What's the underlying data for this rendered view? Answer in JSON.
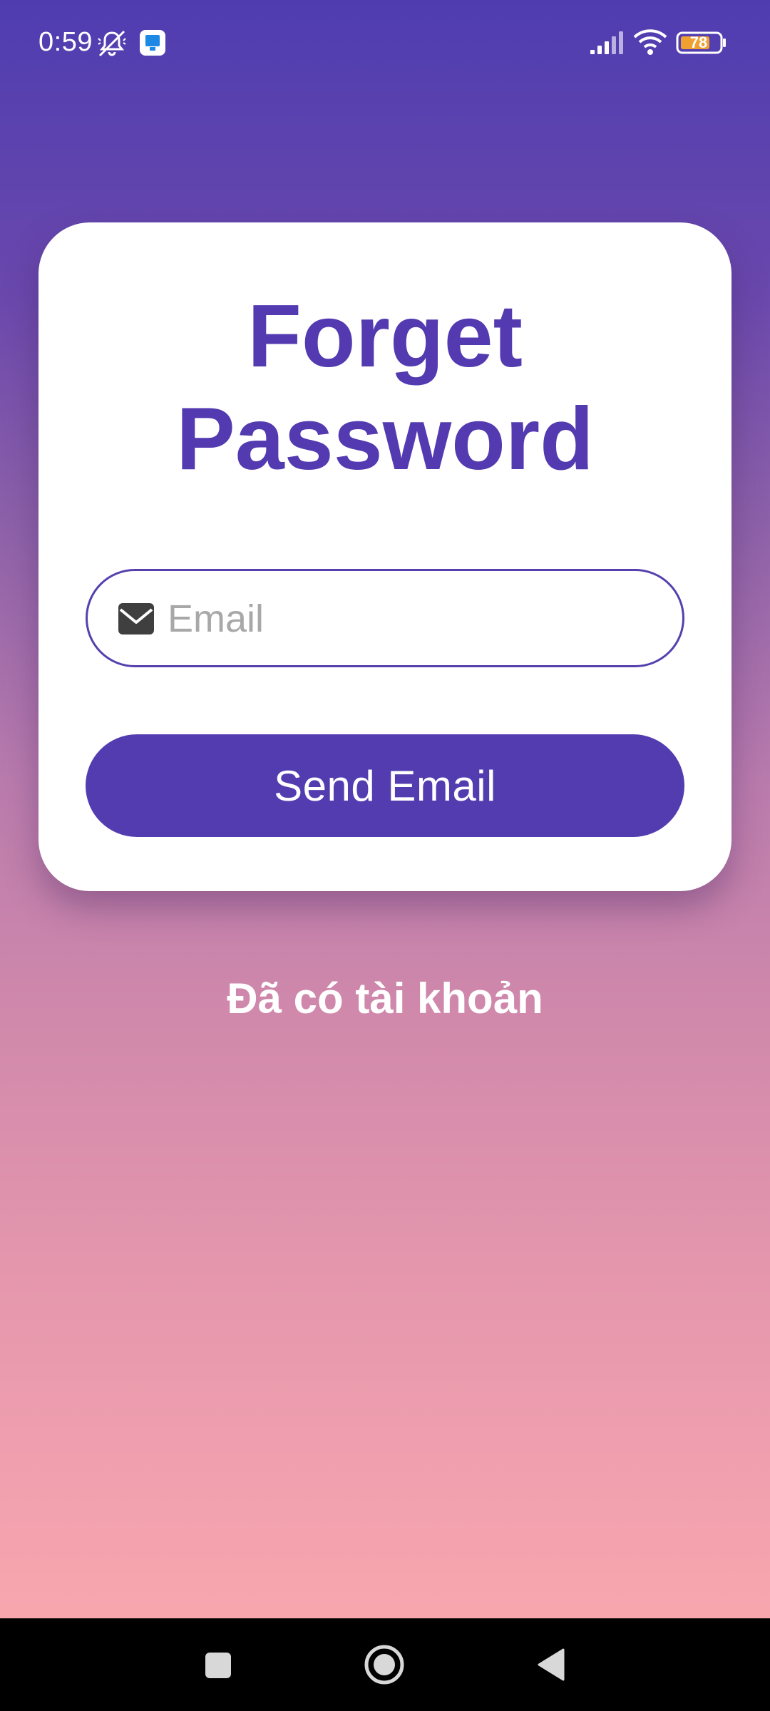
{
  "status_bar": {
    "time": "0:59",
    "battery_level": "78",
    "icons": [
      "bell-off-icon",
      "app-notification-icon",
      "signal-icon",
      "wifi-icon",
      "battery-icon"
    ]
  },
  "form": {
    "title": "Forget\nPassword",
    "email_placeholder": "Email",
    "email_icon": "envelope-icon",
    "send_label": "Send Email"
  },
  "footer": {
    "login_link": "Đã có tài khoản"
  },
  "navigation": {
    "icons": [
      "recent-apps-icon",
      "home-icon",
      "back-icon"
    ]
  },
  "colors": {
    "primary": "#533cb0",
    "gradient_top": "#4f3db0",
    "gradient_bottom": "#f8a6ae"
  }
}
